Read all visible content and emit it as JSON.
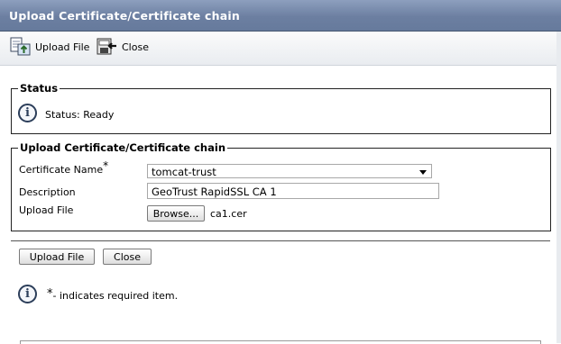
{
  "window": {
    "title": "Upload Certificate/Certificate chain"
  },
  "toolbar": {
    "upload_label": "Upload File",
    "close_label": "Close"
  },
  "status_section": {
    "legend": "Status",
    "text": "Status: Ready"
  },
  "upload_section": {
    "legend": "Upload Certificate/Certificate chain",
    "cert_name_label": "Certificate Name",
    "required_mark": "*",
    "cert_name_value": "tomcat-trust",
    "description_label": "Description",
    "description_value": "GeoTrust RapidSSL CA 1",
    "upload_file_label": "Upload File",
    "browse_label": "Browse...",
    "file_name": "ca1.cer"
  },
  "footer": {
    "upload_button": "Upload File",
    "close_button": "Close",
    "required_mark": "*",
    "required_note": "- indicates required item."
  },
  "icons": {
    "upload": "upload-file-icon",
    "close": "close-window-icon",
    "info": "info-icon"
  },
  "colors": {
    "titlebar": "#6c7fa1",
    "toolbar": "#eef0f3"
  }
}
